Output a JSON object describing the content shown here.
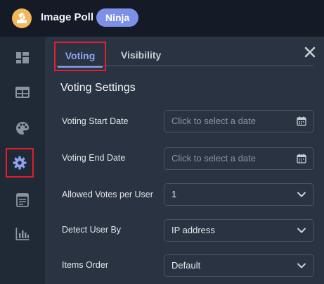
{
  "header": {
    "app_title": "Image Poll",
    "badge": "Ninja",
    "logo_icon": "poll-ballot-icon"
  },
  "sidebar": {
    "items": [
      {
        "icon": "dashboard-icon"
      },
      {
        "icon": "table-icon"
      },
      {
        "icon": "palette-icon"
      },
      {
        "icon": "gear-icon",
        "active": true
      },
      {
        "icon": "form-icon"
      },
      {
        "icon": "chart-icon"
      }
    ]
  },
  "tabs": [
    {
      "label": "Voting",
      "active": true
    },
    {
      "label": "Visibility",
      "active": false
    }
  ],
  "section": {
    "title": "Voting Settings"
  },
  "fields": {
    "start_date": {
      "label": "Voting Start Date",
      "placeholder": "Click to select a date"
    },
    "end_date": {
      "label": "Voting End Date",
      "placeholder": "Click to select a date"
    },
    "votes_per_user": {
      "label": "Allowed Votes per User",
      "value": "1"
    },
    "detect_user": {
      "label": "Detect User By",
      "value": "IP address"
    },
    "items_order": {
      "label": "Items Order",
      "value": "Default"
    }
  },
  "colors": {
    "accent": "#8fa2f0",
    "badge": "#7d8fe6",
    "highlight_box": "#e0202a",
    "logo": "#f1b95b"
  }
}
